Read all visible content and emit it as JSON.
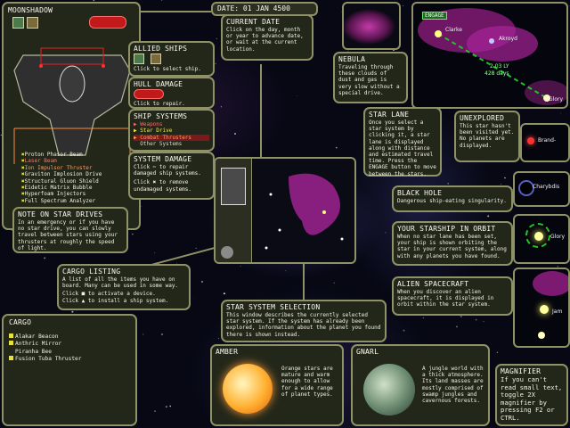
{
  "colors": {
    "panel": "#23271a",
    "border": "#8f9266",
    "accent_red": "#c21a1a",
    "accent_yellow": "#f2ee3a",
    "nebula": "#b0289a"
  },
  "ship_panel": {
    "name": "MOONSHADOW",
    "icons": [
      "escape-pod-icon",
      "shuttle-icon",
      "repair-icon"
    ],
    "systems": [
      {
        "label": "Proton Phasor Beam",
        "color": "#f2f2e0",
        "mark": "x"
      },
      {
        "label": "Laser Beam",
        "color": "#ff7070",
        "mark": "x"
      },
      {
        "label": "Ion Impulsor Thruster",
        "color": "#ff9a5a",
        "mark": "x"
      },
      {
        "label": "Graviton Implosion Drive",
        "color": "#f2f2e0",
        "mark": "x"
      },
      {
        "label": "Structural Gluon Shield",
        "color": "#f2f2e0",
        "mark": "x"
      },
      {
        "label": "Eidetic Matrix Bubble",
        "color": "#f2f2e0",
        "mark": "x"
      },
      {
        "label": "Hyperfoam Injectors",
        "color": "#f2f2e0",
        "mark": "x"
      },
      {
        "label": "Full Spectrum Analyzer",
        "color": "#f2f2e0",
        "mark": "x"
      }
    ]
  },
  "allied_ships": {
    "title": "ALLIED SHIPS",
    "text": "Click to select ship."
  },
  "hull_damage": {
    "title": "HULL DAMAGE",
    "text": "Click to repair."
  },
  "ship_systems": {
    "title": "SHIP SYSTEMS",
    "items": [
      "Weapons",
      "Star Drive",
      "Combat Thrusters",
      "Other Systems"
    ]
  },
  "system_damage": {
    "title": "SYSTEM DAMAGE",
    "text": "Click ✂ to repair damaged ship systems.",
    "text2": "Click ✖ to remove undamaged systems."
  },
  "star_drive_note": {
    "title": "NOTE ON STAR DRIVES",
    "text": "In an emergency or if you have no star drive, you can slowly travel between stars using your thrusters at roughly the speed of light."
  },
  "cargo_listing": {
    "title": "CARGO LISTING",
    "text": "A list of all the items you have on board. Many can be used in some way.",
    "text2": "Click ■ to activate a device.",
    "text3": "Click ▲ to install a ship system."
  },
  "cargo": {
    "title": "CARGO",
    "items": [
      {
        "label": "Alakar Beacon",
        "color": "#e8e040"
      },
      {
        "label": "Anthric Mirror",
        "color": "#e8e040"
      },
      {
        "label": "Piranha Bee",
        "color": ""
      },
      {
        "label": "Fusion Tuba Thruster",
        "color": "#e8e040"
      }
    ]
  },
  "date": {
    "label": "DATE: 01 JAN 4500"
  },
  "current_date": {
    "title": "CURRENT DATE",
    "text": "Click on the day, month or year to advance date, or wait at the current location."
  },
  "nebula": {
    "title": "NEBULA",
    "text": "Traveling through these clouds of dust and gas is very slow without a special drive."
  },
  "star_lane": {
    "title": "STAR LANE",
    "text": "Once you select a star system by clicking it, a star lane is displayed along with distance and estimated travel time. Press the ENGAGE button to move between the stars."
  },
  "unexplored": {
    "title": "UNEXPLORED",
    "text": "This star hasn't been visited yet. No planets are displayed."
  },
  "black_hole": {
    "title": "BLACK HOLE",
    "text": "Dangerous ship-eating singularity."
  },
  "your_starship": {
    "title": "YOUR STARSHIP IN ORBIT",
    "text": "When no star lane has been set, your ship is shown orbiting the star in your current system, along with any planets you have found."
  },
  "alien_spacecraft": {
    "title": "ALIEN SPACECRAFT",
    "text": "When you discover an alien spacecraft, it is displayed in orbit within the star system."
  },
  "star_system_selection": {
    "title": "STAR SYSTEM SELECTION",
    "text": "This window describes the currently selected star system. If the system has already been explored, information about the planet you found there is shown instead."
  },
  "amber": {
    "title": "AMBER",
    "text": "Orange stars are mature and warm enough to allow for a wide range of planet types."
  },
  "gnarl": {
    "title": "GNARL",
    "text": "A jungle world with a thick atmosphere. Its land masses are mostly comprised of swamp jungles and cavernous forests."
  },
  "magnifier": {
    "title": "MAGNIFIER",
    "text": "If you can't read small text, toggle 2X magnifier by pressing F2 or CTRL."
  },
  "map": {
    "engage_label": "ENGAGE",
    "distance": "2.03 LY",
    "travel_time": "428 days",
    "stars": [
      "Clarke",
      "Akroyd",
      "Glory",
      "Brand-",
      "Charybdis",
      "Glory",
      "Jam"
    ]
  }
}
